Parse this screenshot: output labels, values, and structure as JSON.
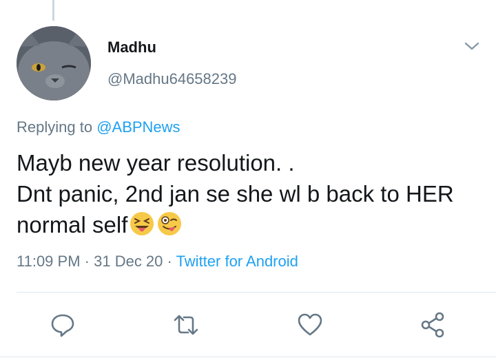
{
  "user": {
    "display_name": "Madhu",
    "handle": "@Madhu64658239"
  },
  "reply": {
    "prefix": "Replying to ",
    "mention": "@ABPNews"
  },
  "tweet": {
    "line1": "Mayb new year resolution. .",
    "line2": "Dnt panic, 2nd jan se she wl b back to HER",
    "line3": "normal self"
  },
  "meta": {
    "time": "11:09 PM",
    "sep1": " · ",
    "date": "31 Dec 20",
    "sep2": " · ",
    "source": "Twitter for Android"
  },
  "icons": {
    "reply": "reply-icon",
    "retweet": "retweet-icon",
    "like": "like-icon",
    "share": "share-icon",
    "more": "chevron-down-icon"
  },
  "colors": {
    "link": "#1da1f2",
    "muted": "#657786",
    "text": "#14171a"
  }
}
